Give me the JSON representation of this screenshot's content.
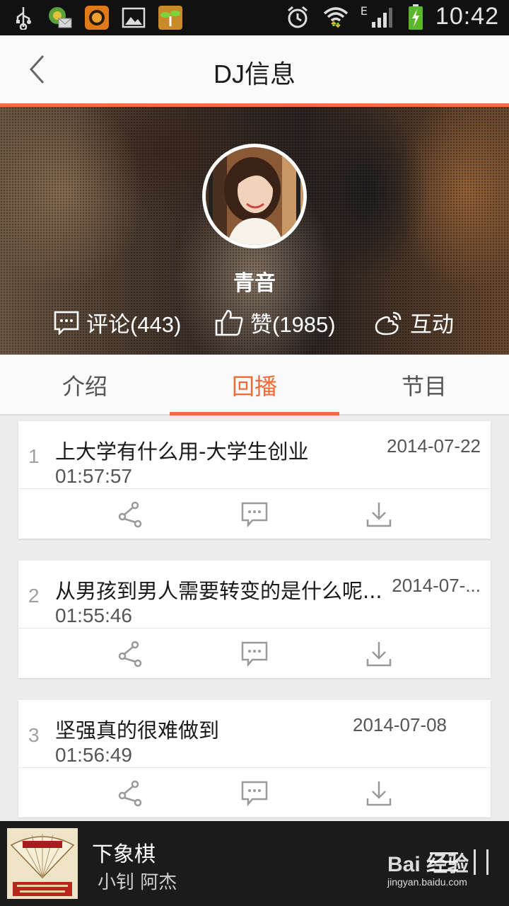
{
  "status_bar": {
    "time": "10:42",
    "network_label": "E",
    "left_icons": [
      "usb-icon",
      "messenger-icon",
      "app-icon",
      "gallery-icon",
      "sprout-icon"
    ],
    "right_icons": [
      "alarm-icon",
      "wifi-icon",
      "signal-icon",
      "battery-charging-icon"
    ]
  },
  "header": {
    "title": "DJ信息"
  },
  "profile": {
    "name": "青音",
    "stats": {
      "comments": "评论(443)",
      "likes": "赞(1985)",
      "interact": "互动"
    }
  },
  "tabs": [
    {
      "label": "介绍",
      "active": false
    },
    {
      "label": "回播",
      "active": true
    },
    {
      "label": "节目",
      "active": false
    }
  ],
  "episodes": [
    {
      "num": "1",
      "title": "上大学有什么用-大学生创业",
      "date": "2014-07-22",
      "duration": "01:57:57"
    },
    {
      "num": "2",
      "title": "从男孩到男人需要转变的是什么呢...",
      "date": "2014-07-...",
      "duration": "01:55:46"
    },
    {
      "num": "3",
      "title": "坚强真的很难做到",
      "date": "2014-07-08",
      "duration": "01:56:49"
    }
  ],
  "player": {
    "song": "下象棋",
    "artist": "小钊 阿杰"
  },
  "watermark": {
    "logo": "Bai 经验",
    "url": "jingyan.baidu.com"
  },
  "colors": {
    "accent": "#f06a38",
    "header_line": "#f07042",
    "player_bg": "#1b1b1b"
  }
}
